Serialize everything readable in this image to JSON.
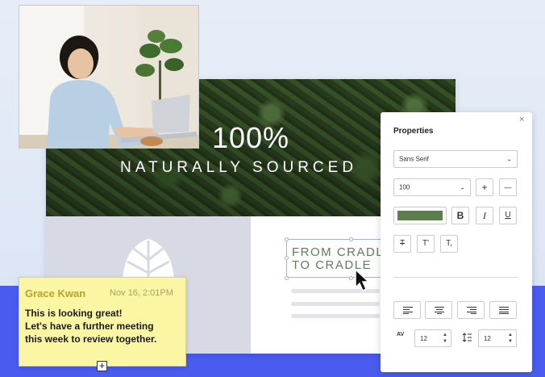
{
  "hero": {
    "title": "100%",
    "subtitle": "NATURALLY SOURCED"
  },
  "canvas": {
    "selected_text_line1": "FROM CRADLE",
    "selected_text_line2": "TO CRADLE"
  },
  "panel": {
    "title": "Properties",
    "close_label": "×",
    "font_family": "Sans Serif",
    "font_size": "100",
    "increase_label": "+",
    "decrease_label": "—",
    "fill_color": "#5b7e4d",
    "bold_label": "B",
    "italic_label": "I",
    "underline_label": "U",
    "strike_label": "T",
    "superscript_label": "T'",
    "subscript_label": "T,",
    "letter_spacing_icon": "AV",
    "letter_spacing_value": "12",
    "line_height_value": "12"
  },
  "sticky": {
    "author": "Grace Kwan",
    "date": "Nov 16, 2:01PM",
    "line1": "This is looking great!",
    "line2": "Let's have a further meeting",
    "line3": "this week to review together.",
    "add_label": "+"
  },
  "colors": {
    "accent_blue": "#4a5cf0",
    "text_green": "#5b8057",
    "sticky_yellow": "#fbf6a4"
  }
}
